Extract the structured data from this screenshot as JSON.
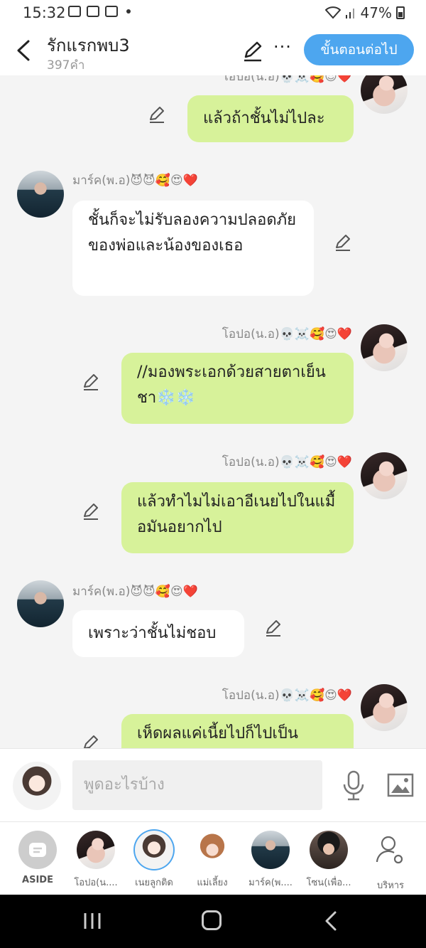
{
  "status_bar": {
    "time": "15:32",
    "battery": "47%"
  },
  "header": {
    "title": "รักแรกพบ3",
    "word_count": "397คำ",
    "more_label": "···",
    "next_button": "ขั้นตอนต่อไป"
  },
  "messages": [
    {
      "speaker": "me",
      "name": "โอปอ(น.อ)💀☠️🥰😍❤️",
      "text": "แล้วถ้าชั้นไม่ไปละ"
    },
    {
      "speaker": "other",
      "name": "มาร์ค(พ.อ)😈😈🥰😍❤️",
      "text": "ชั้นก็จะไม่รับลองความปลอดภัยของพ่อและน้องของเธอ"
    },
    {
      "speaker": "me",
      "name": "โอปอ(น.อ)💀☠️🥰😍❤️",
      "text": "//มองพระเอกด้วยสายตาเย็นชา❄️❄️"
    },
    {
      "speaker": "me",
      "name": "โอปอ(น.อ)💀☠️🥰😍❤️",
      "text": "แล้วทำไมไม่เอาอีเนยไปในแมื้อมันอยากไป"
    },
    {
      "speaker": "other",
      "name": "มาร์ค(พ.อ)😈😈🥰😍❤️",
      "text": "เพราะว่าชั้นไม่ชอบ"
    },
    {
      "speaker": "me",
      "name": "โอปอ(น.อ)💀☠️🥰😍❤️",
      "text": "เห็ดผลแค่เนี้ยไปก็ไปเป็น"
    }
  ],
  "composer": {
    "placeholder": "พูดอะไรบ้าง"
  },
  "characters": [
    {
      "label": "ASIDE"
    },
    {
      "label": "โอปอ(น...."
    },
    {
      "label": "เนยลูกติด"
    },
    {
      "label": "แม่เลี้ยง"
    },
    {
      "label": "มาร์ค(พ...."
    },
    {
      "label": "โซน(เพื่อ..."
    },
    {
      "label": "บริหาร"
    }
  ]
}
